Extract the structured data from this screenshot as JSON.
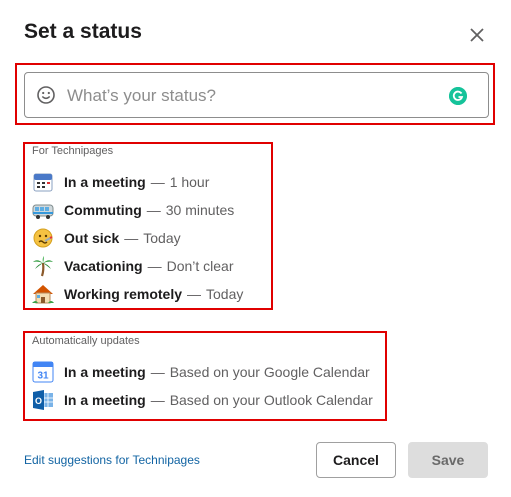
{
  "dialog": {
    "title": "Set a status",
    "close_icon": "close-icon"
  },
  "status_input": {
    "placeholder": "What’s your status?",
    "value": "",
    "emoji_icon": "smiley-icon",
    "extension_icon": "grammarly-icon"
  },
  "workspace_section": {
    "label": "For Technipages",
    "items": [
      {
        "emoji": "calendar-icon",
        "name": "In a meeting",
        "separator": "—",
        "duration": "1 hour"
      },
      {
        "emoji": "bus-icon",
        "name": "Commuting",
        "separator": "—",
        "duration": "30 minutes"
      },
      {
        "emoji": "sick-face-icon",
        "name": "Out sick",
        "separator": "—",
        "duration": "Today"
      },
      {
        "emoji": "palm-tree-icon",
        "name": "Vacationing",
        "separator": "—",
        "duration": "Don’t clear"
      },
      {
        "emoji": "house-icon",
        "name": "Working remotely",
        "separator": "—",
        "duration": "Today"
      }
    ]
  },
  "auto_section": {
    "label": "Automatically updates",
    "items": [
      {
        "emoji": "google-calendar-icon",
        "icon_text": "31",
        "name": "In a meeting",
        "separator": "—",
        "duration": "Based on your Google Calendar"
      },
      {
        "emoji": "outlook-calendar-icon",
        "icon_text": "O",
        "name": "In a meeting",
        "separator": "—",
        "duration": "Based on your Outlook Calendar"
      }
    ]
  },
  "footer": {
    "edit_link": "Edit suggestions for Technipages",
    "cancel_label": "Cancel",
    "save_label": "Save"
  },
  "colors": {
    "highlight": "#e00000",
    "link": "#1264a3",
    "muted_text": "#616061",
    "save_disabled_bg": "#dddddd"
  }
}
